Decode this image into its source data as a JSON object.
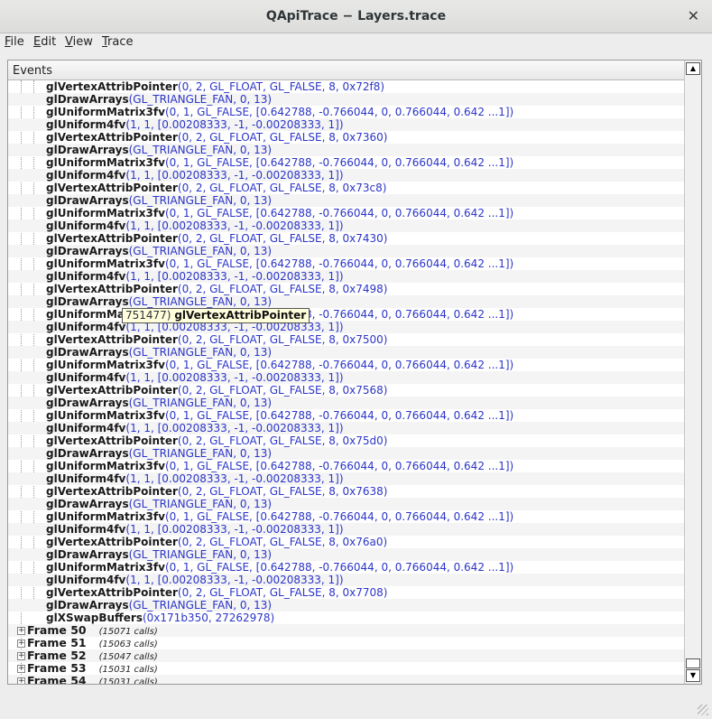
{
  "window": {
    "title": "QApiTrace − Layers.trace"
  },
  "menu": [
    {
      "mnemonic": "F",
      "rest": "ile"
    },
    {
      "mnemonic": "E",
      "rest": "dit"
    },
    {
      "mnemonic": "V",
      "rest": "iew"
    },
    {
      "mnemonic": "T",
      "rest": "race"
    }
  ],
  "events_header": "Events",
  "calls": [
    {
      "fn": "glVertexAttribPointer",
      "args": "0, 2, GL_FLOAT, GL_FALSE, 8, 0x72f8"
    },
    {
      "fn": "glDrawArrays",
      "args": "GL_TRIANGLE_FAN, 0, 13"
    },
    {
      "fn": "glUniformMatrix3fv",
      "args": "0, 1, GL_FALSE, [0.642788, -0.766044, 0, 0.766044, 0.642 ...1]"
    },
    {
      "fn": "glUniform4fv",
      "args": "1, 1, [0.00208333, -1, -0.00208333, 1]"
    },
    {
      "fn": "glVertexAttribPointer",
      "args": "0, 2, GL_FLOAT, GL_FALSE, 8, 0x7360"
    },
    {
      "fn": "glDrawArrays",
      "args": "GL_TRIANGLE_FAN, 0, 13"
    },
    {
      "fn": "glUniformMatrix3fv",
      "args": "0, 1, GL_FALSE, [0.642788, -0.766044, 0, 0.766044, 0.642 ...1]"
    },
    {
      "fn": "glUniform4fv",
      "args": "1, 1, [0.00208333, -1, -0.00208333, 1]"
    },
    {
      "fn": "glVertexAttribPointer",
      "args": "0, 2, GL_FLOAT, GL_FALSE, 8, 0x73c8"
    },
    {
      "fn": "glDrawArrays",
      "args": "GL_TRIANGLE_FAN, 0, 13"
    },
    {
      "fn": "glUniformMatrix3fv",
      "args": "0, 1, GL_FALSE, [0.642788, -0.766044, 0, 0.766044, 0.642 ...1]"
    },
    {
      "fn": "glUniform4fv",
      "args": "1, 1, [0.00208333, -1, -0.00208333, 1]"
    },
    {
      "fn": "glVertexAttribPointer",
      "args": "0, 2, GL_FLOAT, GL_FALSE, 8, 0x7430"
    },
    {
      "fn": "glDrawArrays",
      "args": "GL_TRIANGLE_FAN, 0, 13"
    },
    {
      "fn": "glUniformMatrix3fv",
      "args": "0, 1, GL_FALSE, [0.642788, -0.766044, 0, 0.766044, 0.642 ...1]"
    },
    {
      "fn": "glUniform4fv",
      "args": "1, 1, [0.00208333, -1, -0.00208333, 1]"
    },
    {
      "fn": "glVertexAttribPointer",
      "args": "0, 2, GL_FLOAT, GL_FALSE, 8, 0x7498"
    },
    {
      "fn": "glDrawArrays",
      "args": "GL_TRIANGLE_FAN, 0, 13"
    },
    {
      "fn": "glUniformMatrix3fv",
      "args": "0, 1, GL_FALSE, [0.642788, -0.766044, 0, 0.766044, 0.642 ...1]"
    },
    {
      "fn": "glUniform4fv",
      "args": "1, 1, [0.00208333, -1, -0.00208333, 1]"
    },
    {
      "fn": "glVertexAttribPointer",
      "args": "0, 2, GL_FLOAT, GL_FALSE, 8, 0x7500"
    },
    {
      "fn": "glDrawArrays",
      "args": "GL_TRIANGLE_FAN, 0, 13"
    },
    {
      "fn": "glUniformMatrix3fv",
      "args": "0, 1, GL_FALSE, [0.642788, -0.766044, 0, 0.766044, 0.642 ...1]"
    },
    {
      "fn": "glUniform4fv",
      "args": "1, 1, [0.00208333, -1, -0.00208333, 1]"
    },
    {
      "fn": "glVertexAttribPointer",
      "args": "0, 2, GL_FLOAT, GL_FALSE, 8, 0x7568"
    },
    {
      "fn": "glDrawArrays",
      "args": "GL_TRIANGLE_FAN, 0, 13"
    },
    {
      "fn": "glUniformMatrix3fv",
      "args": "0, 1, GL_FALSE, [0.642788, -0.766044, 0, 0.766044, 0.642 ...1]"
    },
    {
      "fn": "glUniform4fv",
      "args": "1, 1, [0.00208333, -1, -0.00208333, 1]"
    },
    {
      "fn": "glVertexAttribPointer",
      "args": "0, 2, GL_FLOAT, GL_FALSE, 8, 0x75d0"
    },
    {
      "fn": "glDrawArrays",
      "args": "GL_TRIANGLE_FAN, 0, 13"
    },
    {
      "fn": "glUniformMatrix3fv",
      "args": "0, 1, GL_FALSE, [0.642788, -0.766044, 0, 0.766044, 0.642 ...1]"
    },
    {
      "fn": "glUniform4fv",
      "args": "1, 1, [0.00208333, -1, -0.00208333, 1]"
    },
    {
      "fn": "glVertexAttribPointer",
      "args": "0, 2, GL_FLOAT, GL_FALSE, 8, 0x7638"
    },
    {
      "fn": "glDrawArrays",
      "args": "GL_TRIANGLE_FAN, 0, 13"
    },
    {
      "fn": "glUniformMatrix3fv",
      "args": "0, 1, GL_FALSE, [0.642788, -0.766044, 0, 0.766044, 0.642 ...1]"
    },
    {
      "fn": "glUniform4fv",
      "args": "1, 1, [0.00208333, -1, -0.00208333, 1]"
    },
    {
      "fn": "glVertexAttribPointer",
      "args": "0, 2, GL_FLOAT, GL_FALSE, 8, 0x76a0"
    },
    {
      "fn": "glDrawArrays",
      "args": "GL_TRIANGLE_FAN, 0, 13"
    },
    {
      "fn": "glUniformMatrix3fv",
      "args": "0, 1, GL_FALSE, [0.642788, -0.766044, 0, 0.766044, 0.642 ...1]"
    },
    {
      "fn": "glUniform4fv",
      "args": "1, 1, [0.00208333, -1, -0.00208333, 1]"
    },
    {
      "fn": "glVertexAttribPointer",
      "args": "0, 2, GL_FLOAT, GL_FALSE, 8, 0x7708"
    },
    {
      "fn": "glDrawArrays",
      "args": "GL_TRIANGLE_FAN, 0, 13"
    },
    {
      "fn": "glXSwapBuffers",
      "args": "0x171b350, 27262978"
    }
  ],
  "frames": [
    {
      "label": "Frame 50",
      "calls": "(15071 calls)"
    },
    {
      "label": "Frame 51",
      "calls": "(15063 calls)"
    },
    {
      "label": "Frame 52",
      "calls": "(15047 calls)"
    },
    {
      "label": "Frame 53",
      "calls": "(15031 calls)"
    },
    {
      "label": "Frame 54",
      "calls": "(15031 calls)"
    }
  ],
  "tooltip": {
    "number": "751477)",
    "fn": "glVertexAttribPointer"
  },
  "icons": {
    "close": "close-icon",
    "expand": "plus-expander-icon",
    "scroll_up": "triangle-up-icon",
    "scroll_down": "triangle-down-icon"
  }
}
